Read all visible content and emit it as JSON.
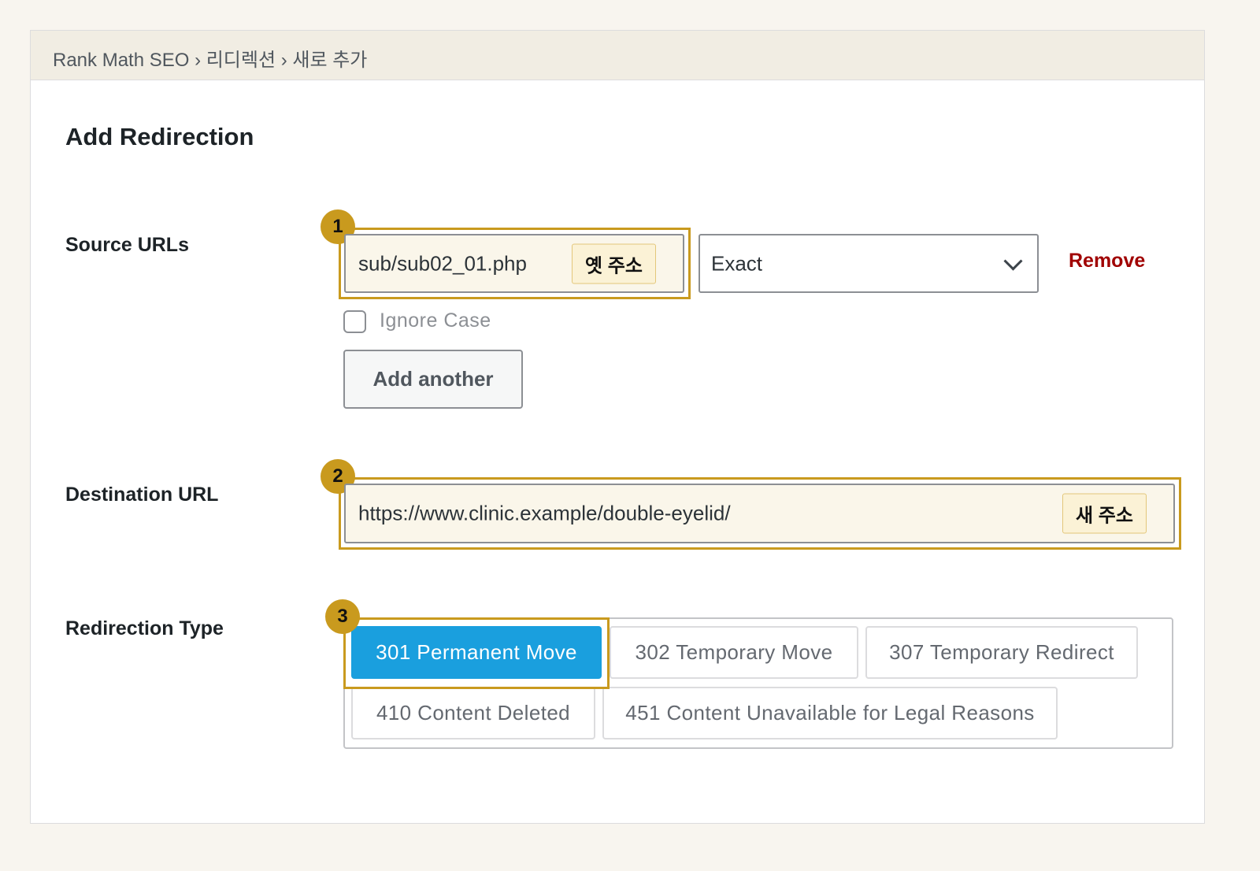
{
  "breadcrumb": "Rank Math SEO › 리디렉션 › 새로 추가",
  "page_title": "Add Redirection",
  "source": {
    "label": "Source URLs",
    "url_value": "sub/sub02_01.php",
    "url_tag": "옛 주소",
    "match_type": "Exact",
    "remove_label": "Remove",
    "ignore_case_label": "Ignore Case",
    "ignore_case_checked": false,
    "add_another_label": "Add another"
  },
  "destination": {
    "label": "Destination URL",
    "url_value": "https://www.clinic.example/double-eyelid/",
    "url_tag": "새 주소"
  },
  "redirection_type": {
    "label": "Redirection Type",
    "options": [
      "301 Permanent Move",
      "302 Temporary Move",
      "307 Temporary Redirect",
      "410 Content Deleted",
      "451 Content Unavailable for Legal Reasons"
    ],
    "selected": "301 Permanent Move"
  },
  "callouts": [
    "1",
    "2",
    "3"
  ],
  "colors": {
    "accent_gold": "#c99a1e",
    "active_blue": "#1a9fde",
    "remove_red": "#a00000"
  },
  "icons": {
    "select_arrow": "chevron-down-icon"
  }
}
